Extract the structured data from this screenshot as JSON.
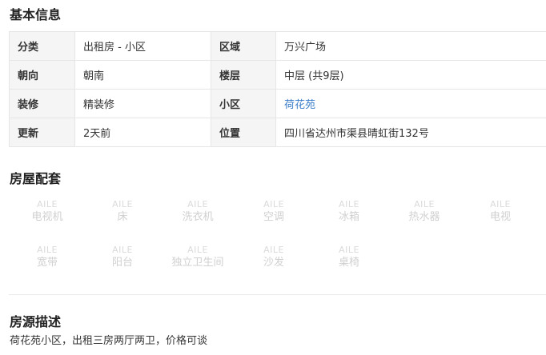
{
  "basic_info": {
    "title": "基本信息",
    "rows": [
      [
        {
          "label": "分类",
          "value": "出租房 - 小区"
        },
        {
          "label": "区域",
          "value": "万兴广场"
        }
      ],
      [
        {
          "label": "朝向",
          "value": "朝南"
        },
        {
          "label": "楼层",
          "value": "中层 (共9层)"
        }
      ],
      [
        {
          "label": "装修",
          "value": "精装修"
        },
        {
          "label": "小区",
          "value": "荷花苑"
        }
      ],
      [
        {
          "label": "更新",
          "value": "2天前"
        },
        {
          "label": "位置",
          "value": "四川省达州市渠县晴虹街132号"
        }
      ]
    ]
  },
  "amenities": {
    "title": "房屋配套",
    "icon_text": "AILE",
    "items": [
      {
        "label": "电视机",
        "available": false
      },
      {
        "label": "床",
        "available": false
      },
      {
        "label": "洗衣机",
        "available": false
      },
      {
        "label": "空调",
        "available": false
      },
      {
        "label": "冰箱",
        "available": false
      },
      {
        "label": "热水器",
        "available": false
      },
      {
        "label": "电视",
        "available": false
      },
      {
        "label": "宽带",
        "available": false
      },
      {
        "label": "阳台",
        "available": false
      },
      {
        "label": "独立卫生间",
        "available": false
      },
      {
        "label": "沙发",
        "available": false
      },
      {
        "label": "桌椅",
        "available": false
      }
    ]
  },
  "description": {
    "title": "房源描述",
    "text": "荷花苑小区，出租三房两厅两卫，价格可谈"
  },
  "colors": {
    "link": "#3a7dc9",
    "label_bg": "#f5f5f5",
    "border": "#e6e6e6",
    "unavailable": "#d0d0d0"
  }
}
